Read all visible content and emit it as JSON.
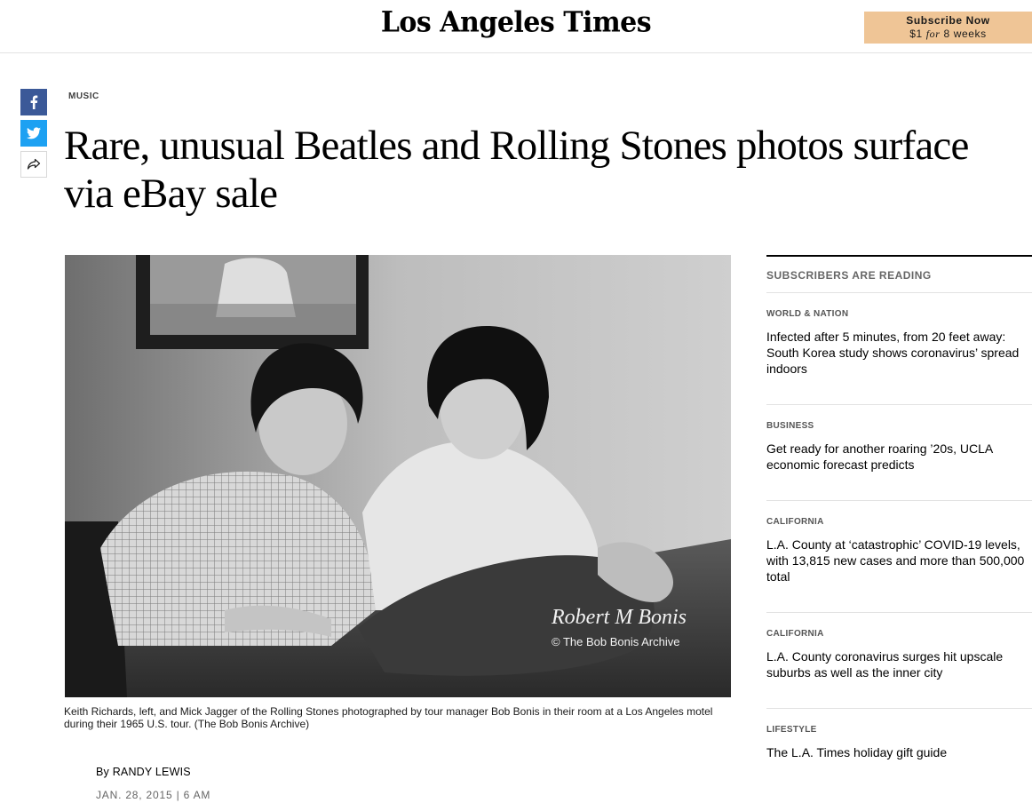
{
  "header": {
    "logo": "Los Angeles Times",
    "subscribe": {
      "line1": "Subscribe Now",
      "price": "$1",
      "for": "for",
      "term": "8 weeks"
    }
  },
  "share": {
    "facebook": "f",
    "twitter": "twitter",
    "more": "share"
  },
  "article": {
    "section": "MUSIC",
    "headline": "Rare, unusual Beatles and Rolling Stones photos surface via eBay sale",
    "photo": {
      "watermark_signature": "Robert M Bonis",
      "watermark_credit": "© The Bob Bonis Archive"
    },
    "caption": "Keith Richards, left, and Mick Jagger of the Rolling Stones photographed by tour manager Bob Bonis in their room at a Los Angeles motel during their 1965 U.S. tour. (The Bob Bonis Archive)",
    "byline_prefix": "By",
    "author": "Randy Lewis",
    "date": "JAN. 28, 2015 | 6 AM"
  },
  "sidebar": {
    "title": "SUBSCRIBERS ARE READING",
    "items": [
      {
        "section": "WORLD & NATION",
        "headline": "Infected after 5 minutes, from 20 feet away:\nSouth Korea study shows coronavirus’ spread\nindoors"
      },
      {
        "section": "BUSINESS",
        "headline": "Get ready for another roaring ’20s, UCLA\neconomic forecast predicts"
      },
      {
        "section": "CALIFORNIA",
        "headline": "L.A. County at ‘catastrophic’ COVID-19 levels,\nwith 13,815 new cases and more than 500,000\ntotal"
      },
      {
        "section": "CALIFORNIA",
        "headline": "L.A. County coronavirus surges hit upscale\nsuburbs as well as the inner city"
      },
      {
        "section": "LIFESTYLE",
        "headline": "The L.A. Times holiday gift guide"
      }
    ]
  }
}
